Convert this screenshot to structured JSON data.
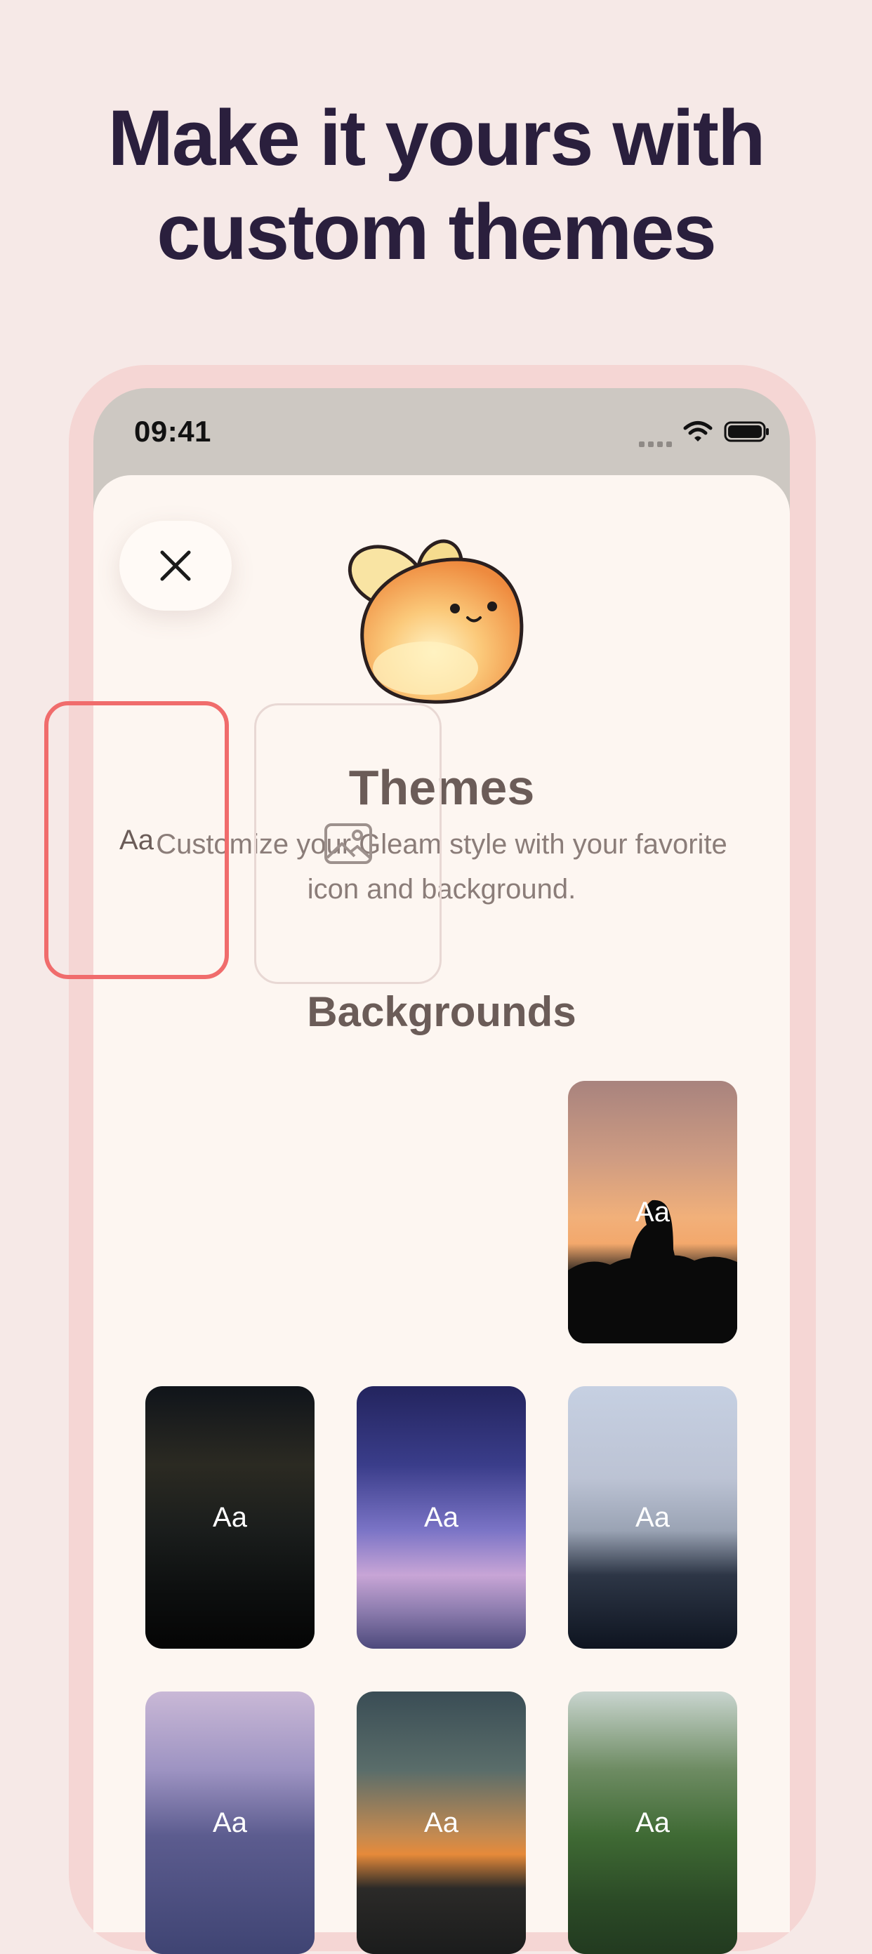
{
  "headline": {
    "line1": "Make it yours with",
    "line2": "custom themes"
  },
  "status_bar": {
    "time": "09:41"
  },
  "sheet": {
    "title": "Themes",
    "description_line1": "Customize your Gleam style with your favorite",
    "description_line2": "icon and background.",
    "section_title": "Backgrounds"
  },
  "backgrounds": [
    {
      "label": "Aa",
      "type": "plain",
      "selected": true
    },
    {
      "type": "upload-photo",
      "icon": "image-icon"
    },
    {
      "label": "Aa",
      "type": "photo",
      "scene": "sunset silhouette"
    },
    {
      "label": "Aa",
      "type": "photo",
      "scene": "dark water"
    },
    {
      "label": "Aa",
      "type": "photo",
      "scene": "purple sky"
    },
    {
      "label": "Aa",
      "type": "photo",
      "scene": "flower at dusk"
    },
    {
      "label": "Aa",
      "type": "photo",
      "scene": "clouds"
    },
    {
      "label": "Aa",
      "type": "photo",
      "scene": "ocean sunset"
    },
    {
      "label": "Aa",
      "type": "photo",
      "scene": "trees"
    }
  ],
  "colors": {
    "page_background": "#f6e9e7",
    "headline": "#2a1f3d",
    "selection_border": "#f06c6c",
    "sheet_background": "#fdf6f1"
  },
  "icons": [
    "close-icon",
    "wifi-icon",
    "battery-icon",
    "cellular-signal-icon",
    "image-icon"
  ]
}
